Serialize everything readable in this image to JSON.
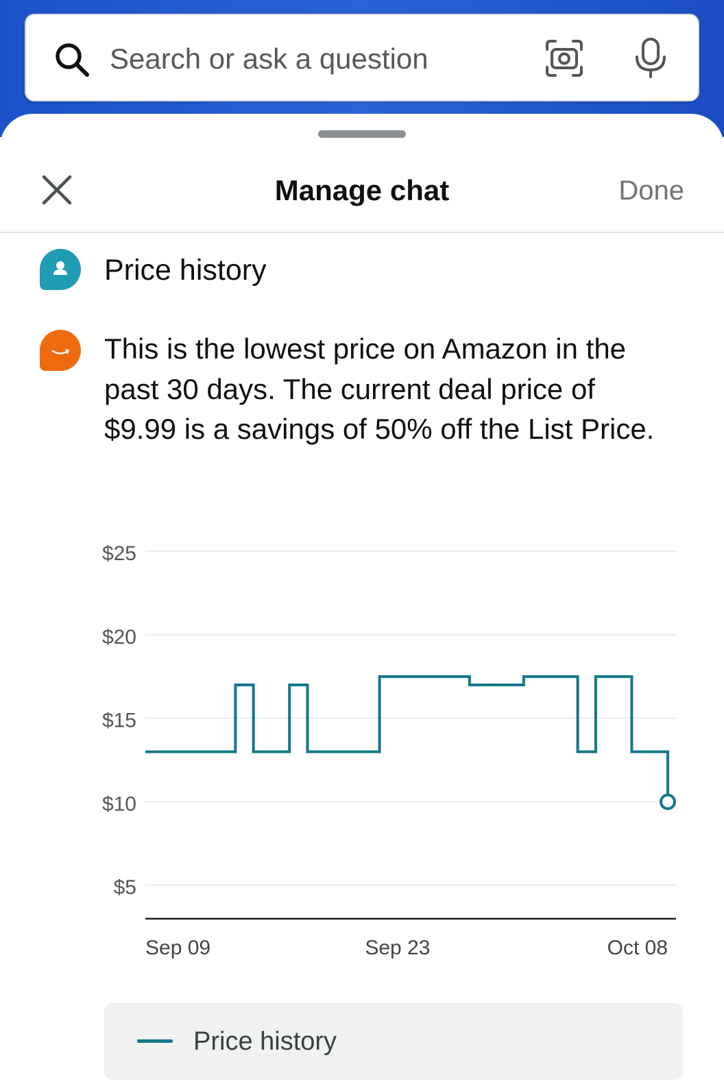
{
  "search": {
    "placeholder": "Search or ask a question",
    "icons": [
      "search-icon",
      "camera-scan-icon",
      "microphone-icon"
    ]
  },
  "header": {
    "title": "Manage chat",
    "done_label": "Done",
    "close_icon": "close-icon"
  },
  "conversation": {
    "user_message": "Price history",
    "assistant_message": "This is the lowest price on Amazon in the past 30 days. The current deal price of $9.99 is a savings of 50% off the List Price."
  },
  "colors": {
    "top_bar": "#1c52c9",
    "user_avatar": "#1f9bb4",
    "assistant_avatar": "#f06b10",
    "series_line": "#137889"
  },
  "chart_data": {
    "type": "line",
    "step": true,
    "title": "",
    "xlabel": "",
    "ylabel": "",
    "ylim": [
      3,
      25
    ],
    "yticks": [
      25,
      20,
      15,
      10,
      5
    ],
    "ytick_labels": [
      "$25",
      "$20",
      "$15",
      "$10",
      "$5"
    ],
    "xtick_labels": [
      "Sep 09",
      "Sep 23",
      "Oct 08"
    ],
    "xtick_dates": [
      "2023-09-09",
      "2023-09-23",
      "2023-10-08"
    ],
    "grid": true,
    "legend": "bottom",
    "series": [
      {
        "name": "Price history",
        "color": "#137889",
        "points": [
          {
            "x": "2023-09-09",
            "y": 12.99
          },
          {
            "x": "2023-09-14",
            "y": 16.99
          },
          {
            "x": "2023-09-15",
            "y": 12.99
          },
          {
            "x": "2023-09-17",
            "y": 16.99
          },
          {
            "x": "2023-09-18",
            "y": 12.99
          },
          {
            "x": "2023-09-22",
            "y": 17.49
          },
          {
            "x": "2023-09-27",
            "y": 16.99
          },
          {
            "x": "2023-09-30",
            "y": 17.49
          },
          {
            "x": "2023-10-03",
            "y": 12.99
          },
          {
            "x": "2023-10-04",
            "y": 17.49
          },
          {
            "x": "2023-10-06",
            "y": 12.99
          },
          {
            "x": "2023-10-08",
            "y": 9.99
          }
        ]
      }
    ]
  },
  "legend": {
    "label": "Price history"
  }
}
